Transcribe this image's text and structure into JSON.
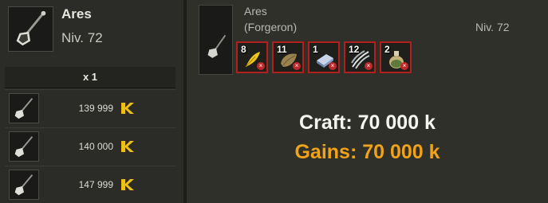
{
  "item": {
    "name": "Ares",
    "level_label": "Niv. 72"
  },
  "left_panel": {
    "quantity_header": "x 1",
    "listings": [
      {
        "price": "139 999"
      },
      {
        "price": "140 000"
      },
      {
        "price": "147 999"
      }
    ]
  },
  "recipe": {
    "name": "Ares",
    "profession": "(Forgeron)",
    "level_label": "Niv. 72",
    "ingredients": [
      {
        "count": "8",
        "icon": "yellow-feather-icon"
      },
      {
        "count": "11",
        "icon": "leather-pouch-icon"
      },
      {
        "count": "1",
        "icon": "blue-stone-icon"
      },
      {
        "count": "12",
        "icon": "silver-claw-icon"
      },
      {
        "count": "2",
        "icon": "potion-flask-icon"
      }
    ]
  },
  "summary": {
    "craft": "Craft: 70 000 k",
    "gains": "Gains: 70 000 k"
  },
  "colors": {
    "accent_gold": "#f0a21a",
    "missing_red": "#b21f1f"
  }
}
